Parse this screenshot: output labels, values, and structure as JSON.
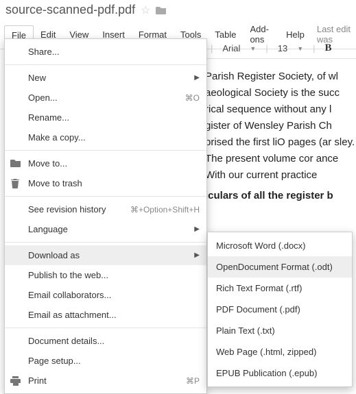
{
  "doc_title": "source-scanned-pdf.pdf",
  "menubar": {
    "items": [
      "File",
      "Edit",
      "View",
      "Insert",
      "Format",
      "Tools",
      "Table",
      "Add-ons",
      "Help"
    ],
    "active_index": 0,
    "last_edit": "Last edit was"
  },
  "toolbar": {
    "font": "Arial",
    "font_size": "13",
    "bold_glyph": "B"
  },
  "document_text": {
    "p1": "Parish Register Society, of wl aeological Society is the succ rical sequence without any l gister of Wensley Parish Ch prised the first liO pages (ar sley. The present volume cor ance With our current practice",
    "p2": "iculars of all the register b"
  },
  "file_menu": {
    "share": "Share...",
    "new": "New",
    "open": "Open...",
    "open_shortcut": "⌘O",
    "rename": "Rename...",
    "make_copy": "Make a copy...",
    "move_to": "Move to...",
    "move_to_trash": "Move to trash",
    "revision": "See revision history",
    "revision_shortcut": "⌘+Option+Shift+H",
    "language": "Language",
    "download_as": "Download as",
    "publish": "Publish to the web...",
    "email_collab": "Email collaborators...",
    "email_attach": "Email as attachment...",
    "doc_details": "Document details...",
    "page_setup": "Page setup...",
    "print": "Print",
    "print_shortcut": "⌘P"
  },
  "download_submenu": {
    "items": [
      "Microsoft Word (.docx)",
      "OpenDocument Format (.odt)",
      "Rich Text Format (.rtf)",
      "PDF Document (.pdf)",
      "Plain Text (.txt)",
      "Web Page (.html, zipped)",
      "EPUB Publication (.epub)"
    ],
    "highlighted_index": 1
  }
}
